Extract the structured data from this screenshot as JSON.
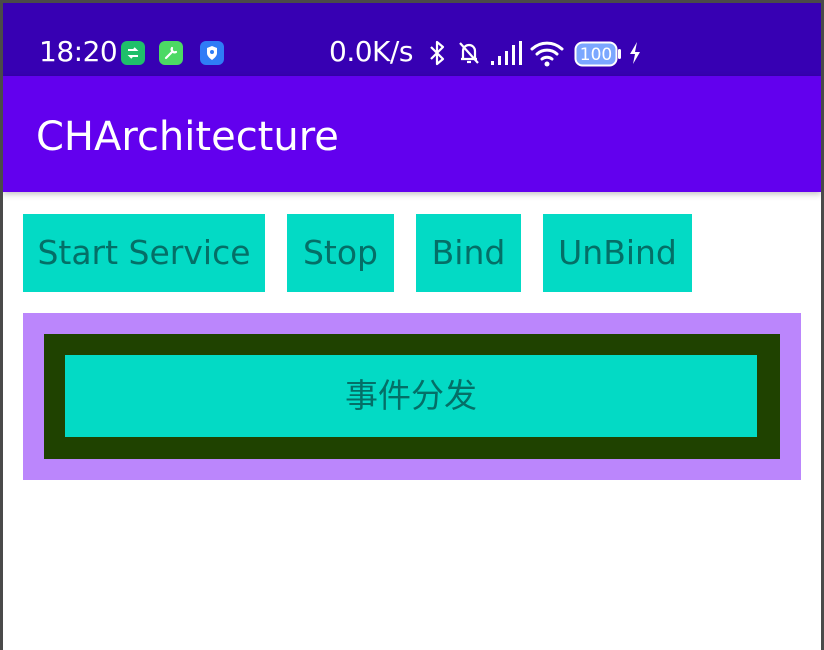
{
  "status_bar": {
    "time": "18:20",
    "net_speed": "0.0K/s",
    "battery": "100",
    "icons": [
      "app-green-icon",
      "wrench-icon",
      "shield-icon",
      "bluetooth-icon",
      "mute-bell-icon",
      "signal-icon",
      "wifi-icon",
      "battery-icon",
      "charging-icon"
    ]
  },
  "app_bar": {
    "title": "CHArchitecture"
  },
  "buttons": {
    "start_service": "Start Service",
    "stop": "Stop",
    "bind": "Bind",
    "unbind": "UnBind",
    "event_dispatch": "事件分发"
  },
  "colors": {
    "status_bar": "#3700b3",
    "app_bar": "#6200ee",
    "button_bg": "#03dac5",
    "button_text": "#046f67",
    "outer_box": "#bb86fc",
    "middle_box": "#1f4200"
  }
}
